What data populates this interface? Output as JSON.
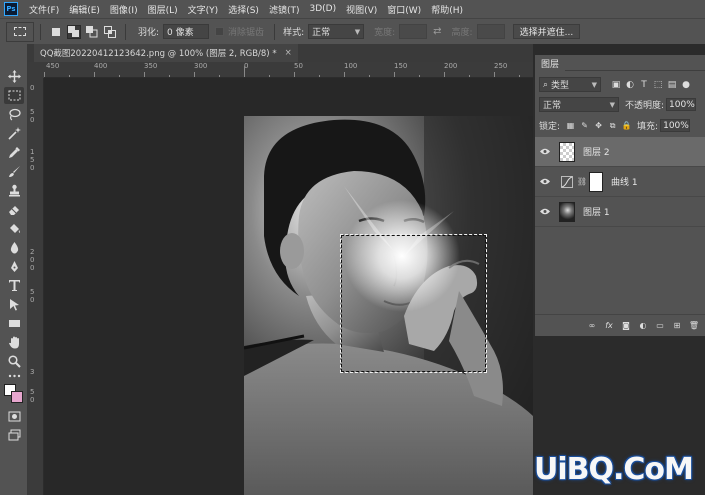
{
  "menubar": {
    "logo": "Ps",
    "items": [
      "文件(F)",
      "编辑(E)",
      "图像(I)",
      "图层(L)",
      "文字(Y)",
      "选择(S)",
      "滤镜(T)",
      "3D(D)",
      "视图(V)",
      "窗口(W)",
      "帮助(H)"
    ]
  },
  "options": {
    "feather_label": "羽化:",
    "feather_value": "0 像素",
    "antialias_label": "消除锯齿",
    "style_label": "样式:",
    "style_value": "正常",
    "width_label": "宽度:",
    "height_label": "高度:",
    "select_mask_button": "选择并遮住..."
  },
  "document": {
    "tab_title": "QQ截图20220412123642.png @ 100% (图层 2, RGB/8) *",
    "close_glyph": "×"
  },
  "rulers": {
    "top": [
      "0",
      "50",
      "100",
      "150",
      "200",
      "250",
      "300",
      "350",
      "400",
      "450"
    ],
    "left": [
      "0",
      "5",
      "0",
      "1",
      "5",
      "0",
      "2",
      "0",
      "0",
      "5",
      "0",
      "3",
      "5",
      "0"
    ]
  },
  "layers_panel": {
    "tab_label": "图层",
    "kind_filter": "类型",
    "blend_mode": "正常",
    "opacity_label": "不透明度:",
    "opacity_value": "100%",
    "lock_label": "锁定:",
    "fill_label": "填充:",
    "fill_value": "100%",
    "layers": [
      {
        "name": "图层 2",
        "type": "pixel",
        "thumbnail": "transparent",
        "visible": true,
        "selected": true
      },
      {
        "name": "曲线 1",
        "type": "adjustment-curves",
        "thumbnail": "mask-white",
        "visible": true,
        "selected": false
      },
      {
        "name": "图层 1",
        "type": "pixel",
        "thumbnail": "photo",
        "visible": true,
        "selected": false
      }
    ]
  },
  "colors": {
    "foreground": "#ffffff",
    "background": "#e7a6ce",
    "ui_panel": "#535353",
    "canvas_bg": "#282828"
  },
  "watermark": {
    "text": "UiBQ.CoM"
  }
}
